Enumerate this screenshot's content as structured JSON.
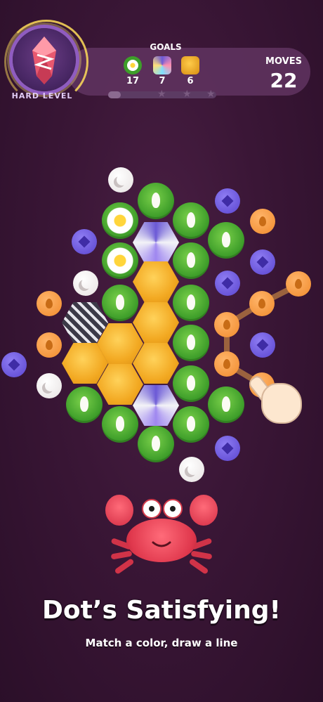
{
  "level": {
    "label": "HARD LEVEL"
  },
  "goals": {
    "title": "GOALS",
    "items": [
      {
        "icon": "lotus-flower-icon",
        "count": "17"
      },
      {
        "icon": "stained-glass-hex-icon",
        "count": "7"
      },
      {
        "icon": "honeycomb-hex-icon",
        "count": "6"
      }
    ]
  },
  "moves": {
    "label": "MOVES",
    "value": "22"
  },
  "progress": {
    "fraction": 0.12,
    "stars_total": 3,
    "stars_earned": 0
  },
  "headline": "Dot’s Satisfying!",
  "subline": "Match a color, draw a line",
  "colors": {
    "background": "#3a1636",
    "purple_dot": "#6b57e0",
    "orange_dot": "#f4973a",
    "white_dot": "#f4f0f0",
    "lily_green": "#4aa82e",
    "honey": "#f2a821",
    "crab_red": "#e0384d"
  }
}
